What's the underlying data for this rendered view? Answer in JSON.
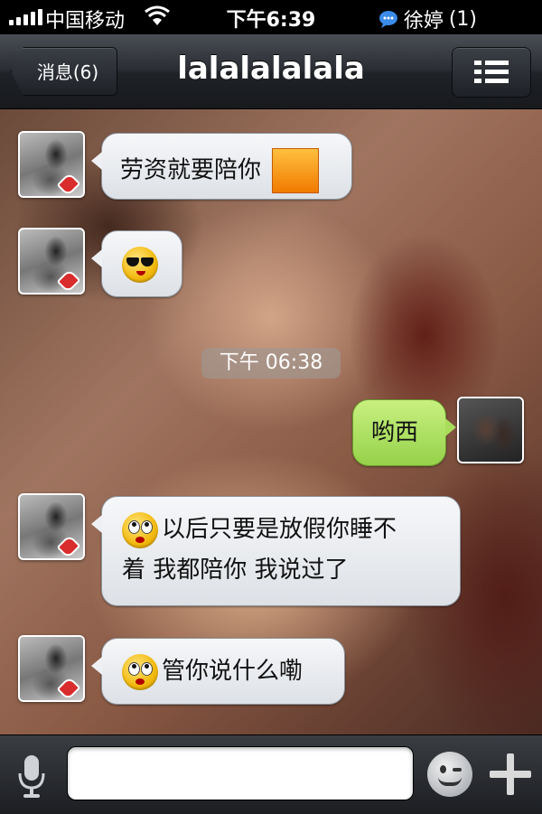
{
  "status_bar": {
    "carrier": "中国移动",
    "time": "下午6:39",
    "notification_name": "徐婷",
    "notification_count": "(1)"
  },
  "nav": {
    "back_label": "消息(6)",
    "title": "lalalalalala"
  },
  "messages": [
    {
      "side": "left",
      "text": "劳资就要陪你",
      "attachment": "orange-image-icon"
    },
    {
      "side": "left",
      "emoji": "cool-sunglasses-emoji"
    },
    {
      "timestamp": "下午 06:38"
    },
    {
      "side": "right",
      "text": "哟西"
    },
    {
      "side": "left",
      "emoji": "eye-roll-emoji",
      "text_line1": "以后只要是放假你睡不",
      "text_line2": "着 我都陪你 我说过了"
    },
    {
      "side": "left",
      "emoji": "eye-roll-emoji",
      "text": "管你说什么嘞"
    }
  ],
  "input": {
    "value": "",
    "placeholder": ""
  },
  "colors": {
    "incoming_bubble": "#eef0f3",
    "outgoing_bubble": "#a8dc5a",
    "nav_bar": "#2a2d33"
  }
}
